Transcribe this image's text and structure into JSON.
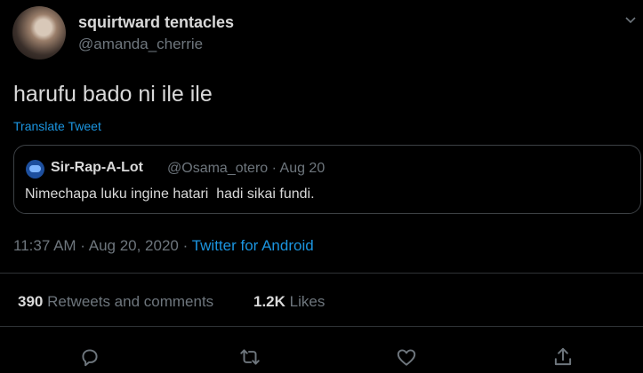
{
  "author": {
    "display_name": "squirtward tentacles",
    "handle": "@amanda_cherrie"
  },
  "tweet": {
    "text": "harufu bado ni ile ile",
    "translate_label": "Translate Tweet"
  },
  "quoted": {
    "display_name": "Sir-Rap-A-Lot",
    "meta": "@Osama_otero · Aug 20",
    "text": "Nimechapa luku ingine hatari  hadi sikai fundi."
  },
  "meta": {
    "time": "11:37 AM · Aug 20, 2020 · ",
    "source": "Twitter for Android"
  },
  "stats": {
    "retweets_count": "390",
    "retweets_label": " Retweets and comments",
    "likes_count": "1.2K",
    "likes_label": " Likes"
  },
  "colors": {
    "background": "#000000",
    "link": "#1b95e0",
    "muted": "#6e767d",
    "text": "#d9d9d9"
  },
  "icons": [
    "reply-icon",
    "retweet-icon",
    "like-icon",
    "share-icon",
    "chevron-down-icon"
  ]
}
